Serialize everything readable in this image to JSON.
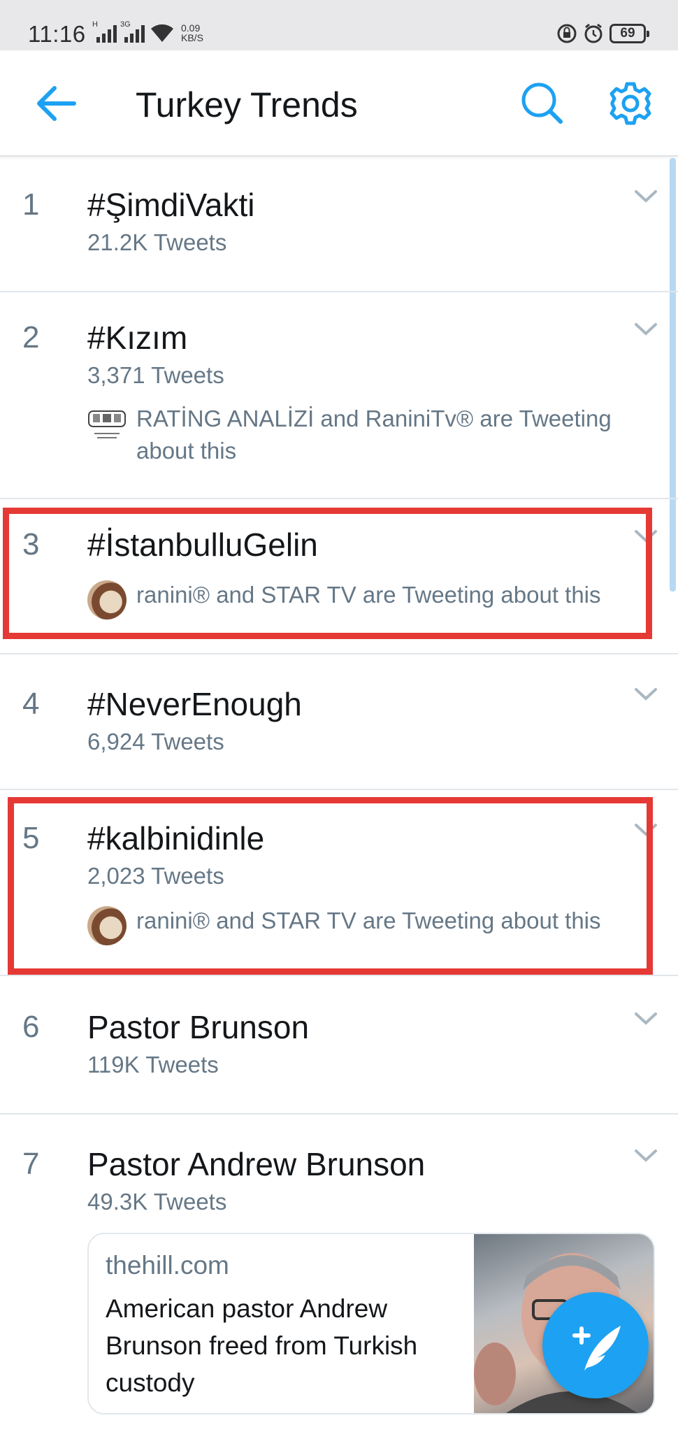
{
  "status_bar": {
    "time": "11:16",
    "network_1": "H",
    "network_2": "3G",
    "speed_value": "0.09",
    "speed_unit": "KB/S",
    "battery": "69"
  },
  "header": {
    "title": "Turkey Trends",
    "back_icon": "arrow-left-icon",
    "search_icon": "search-icon",
    "settings_icon": "gear-icon"
  },
  "trends": [
    {
      "rank": "1",
      "name": "#ŞimdiVakti",
      "count": "21.2K Tweets"
    },
    {
      "rank": "2",
      "name": "#Kızım",
      "count": "3,371 Tweets",
      "context": "RATİNG ANALİZİ and RaniniTv® are Tweeting about this"
    },
    {
      "rank": "3",
      "name": "#İstanbulluGelin",
      "context": "ranini® and STAR TV are Tweeting about this"
    },
    {
      "rank": "4",
      "name": "#NeverEnough",
      "count": "6,924 Tweets"
    },
    {
      "rank": "5",
      "name": "#kalbinidinle",
      "count": "2,023 Tweets",
      "context": "ranini® and STAR TV are Tweeting about this"
    },
    {
      "rank": "6",
      "name": "Pastor Brunson",
      "count": "119K Tweets"
    },
    {
      "rank": "7",
      "name": "Pastor Andrew Brunson",
      "count": "49.3K Tweets"
    }
  ],
  "card": {
    "domain": "thehill.com",
    "title": "American pastor Andrew Brunson freed from Turkish custody"
  },
  "colors": {
    "accent": "#1da1f2",
    "highlight": "#e53935",
    "secondary_text": "#657786"
  }
}
